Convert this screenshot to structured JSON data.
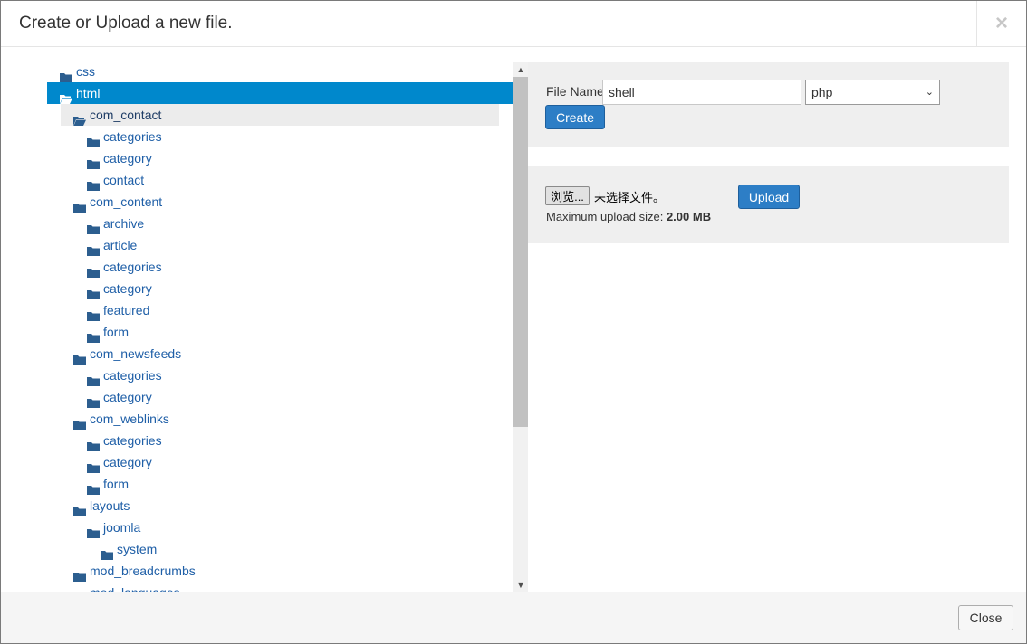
{
  "modal": {
    "title": "Create or Upload a new file.",
    "close_symbol": "×"
  },
  "tree": [
    {
      "label": "css",
      "level": 0
    },
    {
      "label": "html",
      "level": 0,
      "selected": true
    },
    {
      "label": "com_contact",
      "level": 1,
      "hover": true,
      "open": true
    },
    {
      "label": "categories",
      "level": 2
    },
    {
      "label": "category",
      "level": 2
    },
    {
      "label": "contact",
      "level": 2
    },
    {
      "label": "com_content",
      "level": 1
    },
    {
      "label": "archive",
      "level": 2
    },
    {
      "label": "article",
      "level": 2
    },
    {
      "label": "categories",
      "level": 2
    },
    {
      "label": "category",
      "level": 2
    },
    {
      "label": "featured",
      "level": 2
    },
    {
      "label": "form",
      "level": 2
    },
    {
      "label": "com_newsfeeds",
      "level": 1
    },
    {
      "label": "categories",
      "level": 2
    },
    {
      "label": "category",
      "level": 2
    },
    {
      "label": "com_weblinks",
      "level": 1
    },
    {
      "label": "categories",
      "level": 2
    },
    {
      "label": "category",
      "level": 2
    },
    {
      "label": "form",
      "level": 2
    },
    {
      "label": "layouts",
      "level": 1
    },
    {
      "label": "joomla",
      "level": 2
    },
    {
      "label": "system",
      "level": 3
    },
    {
      "label": "mod_breadcrumbs",
      "level": 1
    },
    {
      "label": "mod_languages",
      "level": 1
    }
  ],
  "create_form": {
    "file_name_label": "File Name",
    "file_name_value": "shell",
    "extension_value": "php",
    "create_label": "Create"
  },
  "upload_form": {
    "browse_label": "浏览...",
    "no_file_text": "未选择文件。",
    "upload_label": "Upload",
    "max_size_label": "Maximum upload size:",
    "max_size_value": "2.00 MB"
  },
  "footer": {
    "close_label": "Close"
  },
  "icons": {
    "folder_icon": "folder-icon",
    "folder_open_icon": "folder-open-icon",
    "scroll_up": "▲",
    "scroll_down": "▼",
    "select_chevron": "⌄"
  },
  "colors": {
    "link": "#1f5fa7",
    "selected_bg": "#0088cc",
    "primary_button": "#2d7ec6",
    "well_bg": "#efefef"
  }
}
